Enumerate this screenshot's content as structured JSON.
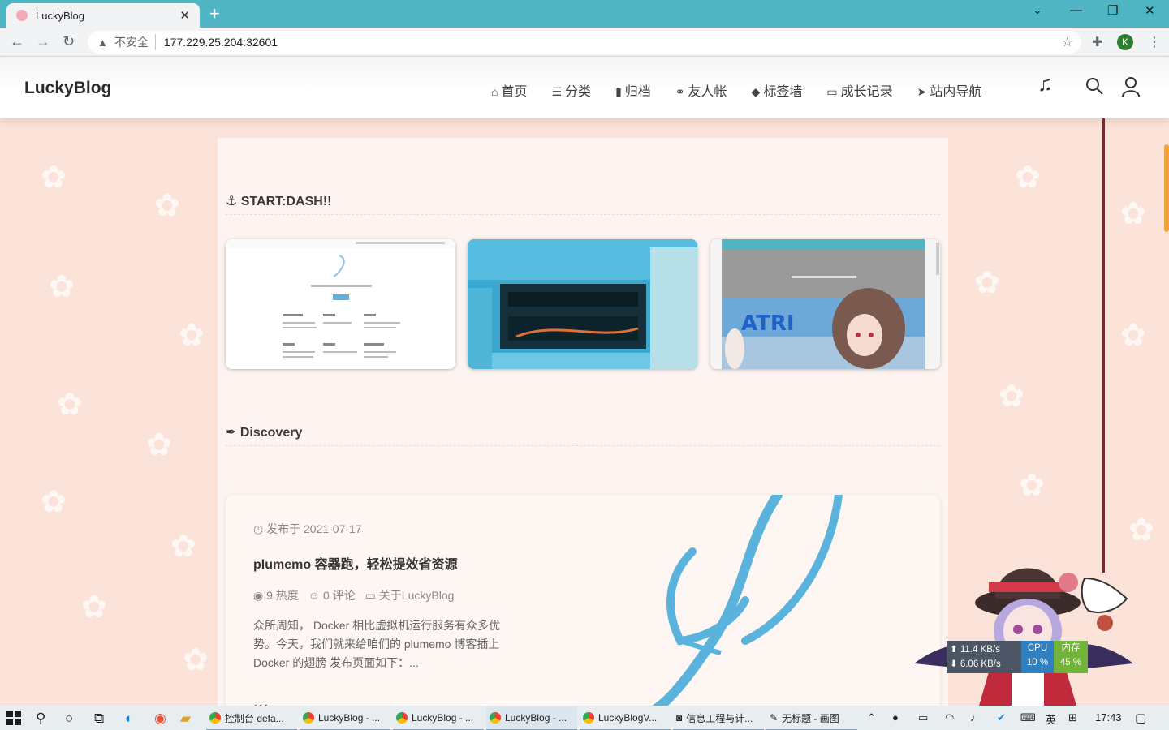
{
  "browser": {
    "tab_title": "LuckyBlog",
    "address_insecure": "不安全",
    "address_url": "177.229.25.204:32601",
    "profile_initial": "K"
  },
  "site": {
    "brand": "LuckyBlog",
    "menu": [
      {
        "icon": "home-icon",
        "glyph": "⌂",
        "label": "首页"
      },
      {
        "icon": "list-icon",
        "glyph": "☰",
        "label": "分类"
      },
      {
        "icon": "archive-icon",
        "glyph": "▮",
        "label": "归档"
      },
      {
        "icon": "link-icon",
        "glyph": "⚭",
        "label": "友人帐"
      },
      {
        "icon": "tag-icon",
        "glyph": "◆",
        "label": "标签墙"
      },
      {
        "icon": "folder-icon",
        "glyph": "▭",
        "label": "成长记录"
      },
      {
        "icon": "send-icon",
        "glyph": "➤",
        "label": "站内导航"
      }
    ]
  },
  "sections": {
    "start_title": "START:DASH!!",
    "discovery_title": "Discovery"
  },
  "post": {
    "date": "发布于 2021-07-17",
    "title": "plumemo 容器跑，轻松提效省资源",
    "views": "9 热度",
    "comments": "0 评论",
    "category": "关于LuckyBlog",
    "excerpt": "众所周知， Docker 相比虚拟机运行服务有众多优势。今天，我们就来给咱们的 plumemo 博客插上 Docker 的翅膀 发布页面如下：...",
    "more": "..."
  },
  "netmon": {
    "up": "11.4 KB/s",
    "down": "6.06 KB/s",
    "cpu_label": "CPU",
    "cpu_value": "10 %",
    "mem_label": "内存",
    "mem_value": "45 %"
  },
  "taskbar": {
    "tasks": [
      "控制台 defa...",
      "LuckyBlog - ...",
      "LuckyBlog - ...",
      "LuckyBlog - ...",
      "LuckyBlogV...",
      "信息工程与计...",
      "无标题 - 画图"
    ],
    "ime": "英",
    "time": "17:43"
  },
  "colors": {
    "page_bg": "#fce3d9",
    "tabbar": "#4fb5c2",
    "scroll_thumb": "#f2a33a",
    "feather": "#5ab3dd"
  }
}
